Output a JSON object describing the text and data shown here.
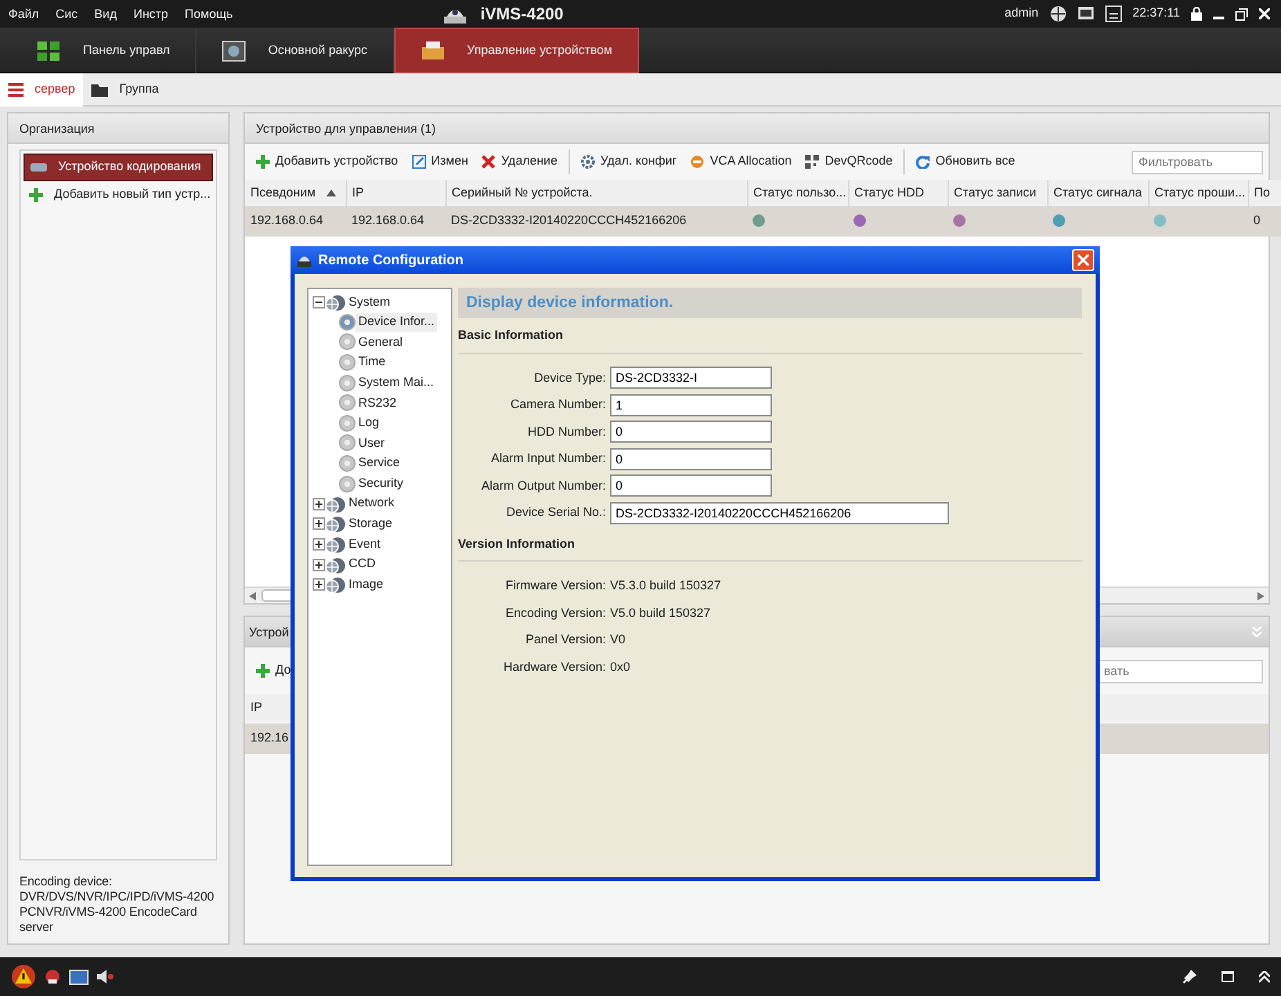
{
  "menu": [
    "Файл",
    "Сис",
    "Вид",
    "Инстр",
    "Помощь"
  ],
  "app_title": "iVMS-4200",
  "status": {
    "user": "admin",
    "time": "22:37:11"
  },
  "main_tabs": [
    {
      "label": "Панель управл",
      "kind": "panel",
      "selected": false
    },
    {
      "label": "Основной ракурс",
      "kind": "view",
      "selected": false
    },
    {
      "label": "Управление устройством",
      "kind": "devices",
      "selected": true
    }
  ],
  "sub_tabs": [
    {
      "label": "сервер",
      "kind": "server",
      "selected": true
    },
    {
      "label": "Группа",
      "kind": "group",
      "selected": false
    }
  ],
  "organization": {
    "title": "Организация",
    "items": [
      {
        "label": "Устройство кодирования",
        "kind": "device",
        "selected": true
      },
      {
        "label": "Добавить новый тип устр...",
        "kind": "add",
        "selected": false
      }
    ],
    "description": [
      "Encoding device:",
      "DVR/DVS/NVR/IPC/IPD/iVMS-4200",
      "PCNVR/iVMS-4200 EncodeCard",
      "server"
    ]
  },
  "devices_panel": {
    "title": "Устройство для управления (1)",
    "toolbar": [
      {
        "label": "Добавить устройство",
        "kind": "add"
      },
      {
        "label": "Измен",
        "kind": "edit"
      },
      {
        "label": "Удаление",
        "kind": "delete"
      },
      {
        "label": "Удал. конфиг",
        "kind": "config"
      },
      {
        "label": "VCA Allocation",
        "kind": "vca"
      },
      {
        "label": "DevQRcode",
        "kind": "qr"
      },
      {
        "label": "Обновить все",
        "kind": "refresh"
      }
    ],
    "filter": {
      "placeholder": "Фильтровать"
    },
    "columns": [
      "Псевдоним",
      "IP",
      "Серийный № устройста.",
      "Статус пользо...",
      "Статус HDD",
      "Статус записи",
      "Статус сигнала",
      "Статус проши...",
      "По"
    ],
    "rows": [
      {
        "selected": true,
        "cells": [
          "192.168.0.64",
          "192.168.0.64",
          "DS-2CD3332-I20140220CCCH452166206"
        ],
        "statuses": [
          {
            "color": "#6f9c8c"
          },
          {
            "color": "#9a68b4"
          },
          {
            "color": "#a874a8"
          },
          {
            "color": "#4e9eb4"
          },
          {
            "color": "#86bcc4"
          }
        ],
        "last": "0"
      }
    ]
  },
  "groups_panel": {
    "title": "Устрой",
    "add_label": "До",
    "filter": {
      "placeholder": "вать"
    },
    "column": "IP",
    "row": {
      "cell": "192.16",
      "selected": true
    }
  },
  "dialog": {
    "title": "Remote Configuration",
    "tree": [
      {
        "label": "System",
        "expanded": true,
        "selected": false,
        "children": [
          {
            "label": "Device Infor...",
            "selected": true
          },
          {
            "label": "General",
            "selected": false
          },
          {
            "label": "Time",
            "selected": false
          },
          {
            "label": "System Mai...",
            "selected": false
          },
          {
            "label": "RS232",
            "selected": false
          },
          {
            "label": "Log",
            "selected": false
          },
          {
            "label": "User",
            "selected": false
          },
          {
            "label": "Service",
            "selected": false
          },
          {
            "label": "Security",
            "selected": false
          }
        ]
      },
      {
        "label": "Network",
        "expanded": false,
        "selected": false
      },
      {
        "label": "Storage",
        "expanded": false,
        "selected": false
      },
      {
        "label": "Event",
        "expanded": false,
        "selected": false
      },
      {
        "label": "CCD",
        "expanded": false,
        "selected": false
      },
      {
        "label": "Image",
        "expanded": false,
        "selected": false
      }
    ],
    "heading": "Display device information.",
    "sections": [
      {
        "title": "Basic Information",
        "fields": [
          {
            "label": "Device Type:",
            "value": "DS-2CD3332-I",
            "kind": "short"
          },
          {
            "label": "Camera Number:",
            "value": "1",
            "kind": "short"
          },
          {
            "label": "HDD Number:",
            "value": "0",
            "kind": "short"
          },
          {
            "label": "Alarm Input Number:",
            "value": "0",
            "kind": "short"
          },
          {
            "label": "Alarm Output Number:",
            "value": "0",
            "kind": "short"
          },
          {
            "label": "Device Serial No.:",
            "value": "DS-2CD3332-I20140220CCCH452166206",
            "kind": "long"
          }
        ]
      },
      {
        "title": "Version Information",
        "fields": [
          {
            "label": "Firmware Version:",
            "value": "V5.3.0 build 150327",
            "kind": "text"
          },
          {
            "label": "Encoding Version:",
            "value": "V5.0 build 150327",
            "kind": "text"
          },
          {
            "label": "Panel Version:",
            "value": "V0",
            "kind": "text"
          },
          {
            "label": "Hardware Version:",
            "value": "0x0",
            "kind": "text"
          }
        ]
      }
    ]
  }
}
